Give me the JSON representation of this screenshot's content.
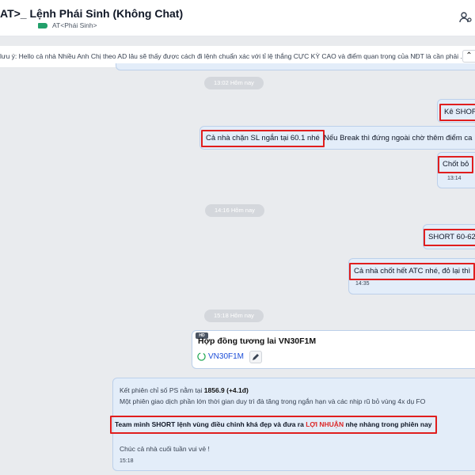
{
  "header": {
    "title": "AT>_ Lệnh Phái Sinh (Không Chat)",
    "subtitle": "AT<Phái Sinh>"
  },
  "pinned": {
    "text": "lưu ý: Hello cả nhà Nhiều Anh Chị theo AD lâu sẽ thấy được cách đi lệnh chuẩn xác với tỉ lệ thắng CỰC KỲ CAO và điểm quan trọng của NĐT là cần phải ..."
  },
  "separators": [
    "13:02 Hôm nay",
    "14:16 Hôm nay",
    "15:18 Hôm nay"
  ],
  "messages": [
    {
      "text": "Kê SHOR"
    },
    {
      "text": "Cả nhà chặn SL ngắn tại 60.1 nhé",
      "rest": "Nếu Break thì đứng ngoài chờ thêm điểm ca"
    },
    {
      "text": "Chốt bỏ",
      "time": "13:14"
    },
    {
      "text": "SHORT 60-62"
    },
    {
      "text": "Cả nhà chốt hết ATC nhé, đỏ lại thì",
      "time": "14:35"
    }
  ],
  "card": {
    "badge": "HD",
    "title": "Hợp đồng tương lai VN30F1M",
    "link": "VN30F1M"
  },
  "summary": {
    "line1_pre": "Kết phiên chỉ số PS nằm tại ",
    "line1_bold": "1856.9 (+4.1đ)",
    "line2": "Một phiên giao dịch phần lớn thời gian duy trì đà tăng trong ngắn hạn và các nhịp rũ bỏ vùng 4x dụ FO",
    "line3_pre": "Team mình SHORT lệnh vùng điều chỉnh khá đẹp và đưa ra ",
    "line3_profit": "LỢI NHUẬN",
    "line3_post": " nhẹ nhàng trong phiên nay",
    "line4": "Chúc cả nhà cuối tuần vui vẻ !",
    "time": "15:18"
  },
  "colors": {
    "highlight": "#e01e1e",
    "bubble": "#e3edf9",
    "tag": "#22a06b",
    "profit": "#dc2626"
  },
  "icons": [
    "tag-icon",
    "user-settings-icon",
    "collapse-icon",
    "check-circle-icon",
    "pencil-icon"
  ]
}
